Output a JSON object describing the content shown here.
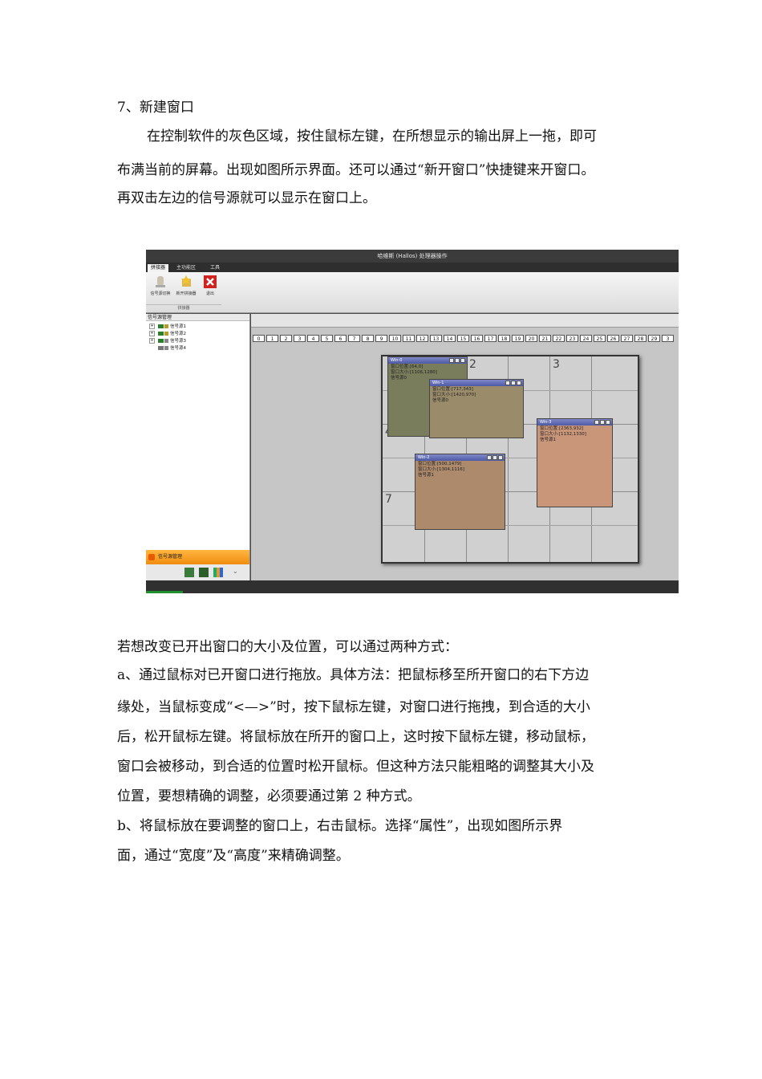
{
  "heading": "7、新建窗口",
  "intro": [
    "在控制软件的灰色区域，按住鼠标左键，在所想显示的输出屏上一拖，即可",
    "布满当前的屏幕。出现如图所示界面。还可以通过“新开窗口”快捷键来开窗口。",
    "再双击左边的信号源就可以显示在窗口上。"
  ],
  "after": [
    "若想改变已开出窗口的大小及位置，可以通过两种方式：",
    "a、通过鼠标对已开窗口进行拖放。具体方法：把鼠标移至所开窗口的右下方边",
    "缘处，当鼠标变成“<—>”时，按下鼠标左键，对窗口进行拖拽，到合适的大小",
    "后，松开鼠标左键。将鼠标放在所开的窗口上，这时按下鼠标左键，移动鼠标，",
    "窗口会被移动，到合适的位置时松开鼠标。但这种方法只能粗略的调整其大小及",
    "位置，要想精确的调整，必须要通过第 2 种方式。",
    "b、将鼠标放在要调整的窗口上，右击鼠标。选择“属性”，出现如图所示界",
    "面，通过“宽度”及“高度”来精确调整。"
  ],
  "screenshot": {
    "title": "哈维斯 (Hallos) 处理器操作",
    "tabs": [
      "拼接器",
      "主功能区",
      "工具"
    ],
    "ribbon_buttons": [
      "信号源切换",
      "新开拼接器",
      "退出"
    ],
    "ribbon_group": "拼接器",
    "left_panel_title": "信号源管理",
    "sources": [
      "信号源1",
      "信号源2",
      "信号源3",
      "信号源4"
    ],
    "left_bottom_tab": "信号源管理",
    "ruler": [
      "0",
      "1",
      "2",
      "3",
      "4",
      "5",
      "6",
      "7",
      "8",
      "9",
      "10",
      "11",
      "12",
      "13",
      "14",
      "15",
      "16",
      "17",
      "18",
      "19",
      "20",
      "21",
      "22",
      "23",
      "24",
      "25",
      "26",
      "27",
      "28",
      "29",
      "3"
    ],
    "screen_numbers": [
      "2",
      "3",
      "4",
      "7"
    ],
    "windows": [
      {
        "title": "Win-0",
        "l1": "窗口位置:[64,0]",
        "l2": "窗口大小:[1106,1280]",
        "l3": "信号源0",
        "color": "#7a7d5c"
      },
      {
        "title": "Win-1",
        "l1": "窗口位置:[717,343]",
        "l2": "窗口大小:[1420,970]",
        "l3": "信号源0",
        "color": "#9a8c6a"
      },
      {
        "title": "Win-3",
        "l1": "窗口位置:[2363,932]",
        "l2": "窗口大小:[1132,1330]",
        "l3": "信号源1",
        "color": "#c9967a"
      },
      {
        "title": "Win-2",
        "l1": "窗口位置:[500,1479]",
        "l2": "窗口大小:[1304,1116]",
        "l3": "信号源1",
        "color": "#ad8a6c"
      }
    ]
  },
  "colors": {
    "orange_bar": "#f5a12a",
    "title_blue": "#5a66b0"
  }
}
